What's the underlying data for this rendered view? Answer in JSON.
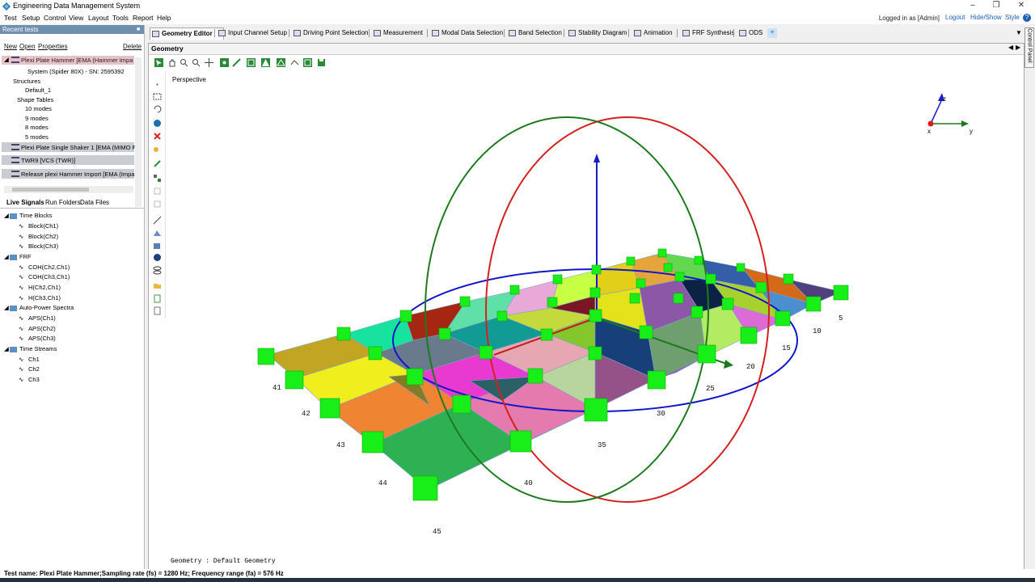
{
  "window": {
    "title": "Engineering Data Management System"
  },
  "menubar": {
    "items": [
      "Test",
      "Setup",
      "Control",
      "View",
      "Layout",
      "Tools",
      "Report",
      "Help"
    ]
  },
  "topright": {
    "login": "Logged in as [Admin]",
    "logout": "Logout",
    "hideshow": "Hide/Show",
    "style": "Style"
  },
  "recent_tests": {
    "header": "Recent tests",
    "new": "New",
    "open": "Open",
    "properties": "Properties",
    "delete": "Delete",
    "items": [
      "Plexi Plate Hammer   [EMA (Hammer Impa",
      "System (Spider 80X) - SN: 2595392",
      "Structures",
      "Default_1",
      "Shape Tables",
      "10 modes",
      "9 modes",
      "8 modes",
      "5 modes",
      "Plexi Plate Single Shaker 1   [EMA (MIMO F",
      "TWR9   [VCS (TWR)]",
      "Release plexi Hammer Import   [EMA (Impa"
    ]
  },
  "signals": {
    "tabs": [
      "Live Signals",
      "Run Folders",
      "Data Files"
    ],
    "groups": [
      {
        "label": "Time Blocks",
        "children": [
          "Block(Ch1)",
          "Block(Ch2)",
          "Block(Ch3)"
        ]
      },
      {
        "label": "FRF",
        "children": [
          "COH(Ch2,Ch1)",
          "COH(Ch3,Ch1)",
          "H(Ch2,Ch1)",
          "H(Ch3,Ch1)"
        ]
      },
      {
        "label": "Auto-Power Spectra",
        "children": [
          "APS(Ch1)",
          "APS(Ch2)",
          "APS(Ch3)"
        ]
      },
      {
        "label": "Time Streams",
        "children": [
          "Ch1",
          "Ch2",
          "Ch3"
        ]
      }
    ]
  },
  "tabs": [
    "Geometry Editor",
    "Input Channel Setup",
    "Driving Point Selection",
    "Measurement",
    "Modal Data Selection",
    "Band Selection",
    "Stability Diagram",
    "Animation",
    "FRF Synthesis",
    "ODS"
  ],
  "geometry": {
    "title": "Geometry",
    "view": "Perspective",
    "footer": "Geometry : Default Geometry",
    "axes": {
      "z": "z",
      "x": "x",
      "y": "y"
    },
    "node_labels": [
      "5",
      "10",
      "15",
      "20",
      "25",
      "30",
      "35",
      "40",
      "41",
      "42",
      "43",
      "44",
      "45"
    ]
  },
  "control_panel": "Control Panel",
  "status": "Test name: Plexi Plate Hammer;Sampling rate (fs) = 1280 Hz; Frequency range (fa) =  576 Hz"
}
